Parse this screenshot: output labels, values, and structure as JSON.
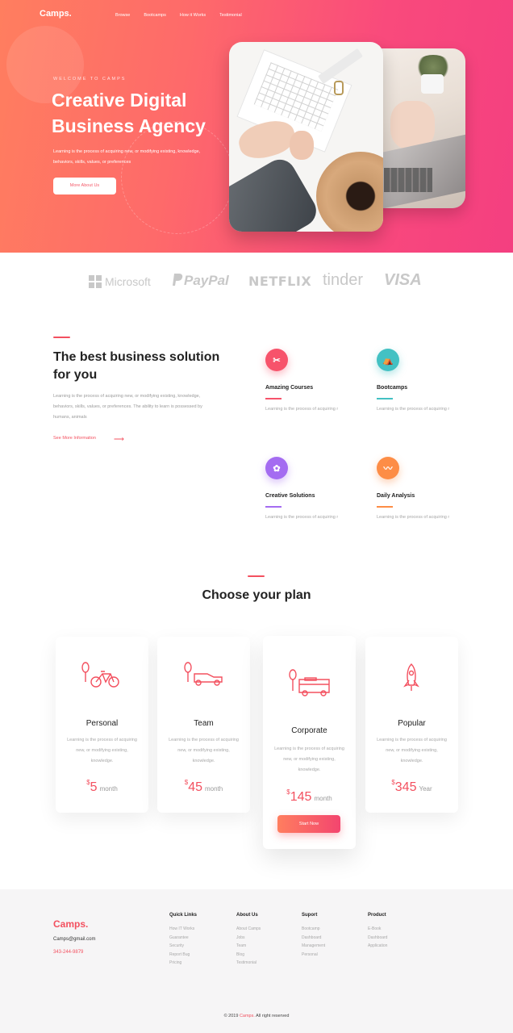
{
  "nav": {
    "logo": "Camps.",
    "links": [
      "Browse",
      "Bootcamps",
      "How it Works",
      "Testimonial"
    ]
  },
  "hero": {
    "kicker": "WELCOME TO CAMPS",
    "title": "Creative Digital Business Agency",
    "description": "Learning is the process of acquiring new, or modifying existing, knowledge, behaviors, skills, values, or preferences",
    "button_label": "More About Us"
  },
  "brands": [
    "Microsoft",
    "PayPal",
    "NETFLIX",
    "tinder",
    "VISA"
  ],
  "features": {
    "title": "The best business solution for you",
    "description": "Learning is the process of acquiring new, or modifying existing, knowledge, behaviors, skills, values, or preferences. The ability to learn is possessed by humans, animals",
    "link_label": "See More Information",
    "items": [
      {
        "name": "Amazing Courses",
        "text": "Learning is the process of acquiring new, or modifying",
        "icon": "tools-icon",
        "color": "#f7536b"
      },
      {
        "name": "Bootcamps",
        "text": "Learning is the process of acquiring new, or modifying",
        "icon": "bootcamp-icon",
        "color": "#43c1c3"
      },
      {
        "name": "Creative Solutions",
        "text": "Learning is the process of acquiring new, or modifying c",
        "icon": "award-icon",
        "color": "#a46cf1"
      },
      {
        "name": "Daily Analysis",
        "text": "Learning is the process of acquiring new, or modifying c",
        "icon": "chart-icon",
        "color": "#fd8d46"
      }
    ]
  },
  "plans": {
    "title": "Choose your plan",
    "items": [
      {
        "name": "Personal",
        "description": "Learning is the process of acquiring new, or modifying existing, knowledge.",
        "currency": "$",
        "price": "5",
        "period": "month",
        "icon": "bicycle-icon"
      },
      {
        "name": "Team",
        "description": "Learning is the process of acquiring new, or modifying existing, knowledge.",
        "currency": "$",
        "price": "45",
        "period": "month",
        "icon": "car-icon"
      },
      {
        "name": "Corporate",
        "description": "Learning is the process of acquiring new, or modifying existing, knowledge.",
        "currency": "$",
        "price": "145",
        "period": "month",
        "icon": "bus-icon"
      },
      {
        "name": "Popular",
        "description": "Learning is the process of acquiring new, or modifying existing, knowledge.",
        "currency": "$",
        "price": "345",
        "period": "Year",
        "icon": "rocket-icon"
      }
    ],
    "cta_label": "Start Now"
  },
  "footer": {
    "logo": "Camps.",
    "email": "Camps@gmail.com",
    "phone": "343-244-9879",
    "columns": [
      {
        "title": "Quick Links",
        "items": [
          "How IT Works",
          "Guarantee",
          "Security",
          "Report Bug",
          "Pricing"
        ]
      },
      {
        "title": "About Us",
        "items": [
          "About Camps",
          "Jobs",
          "Team",
          "Blog",
          "Testimonial"
        ]
      },
      {
        "title": "Suport",
        "items": [
          "Bootcamp",
          "Dashboard",
          "Management",
          "Personal"
        ]
      },
      {
        "title": "Product",
        "items": [
          "E-Book",
          "Dashboard",
          "Application"
        ]
      }
    ],
    "copyright_prefix": "© 2019",
    "copyright_brand": "Camps.",
    "copyright_suffix": "All right reserved"
  },
  "colors": {
    "accent": "#f3505f",
    "hero_start": "#ff7e5f",
    "hero_end": "#f43f80"
  }
}
